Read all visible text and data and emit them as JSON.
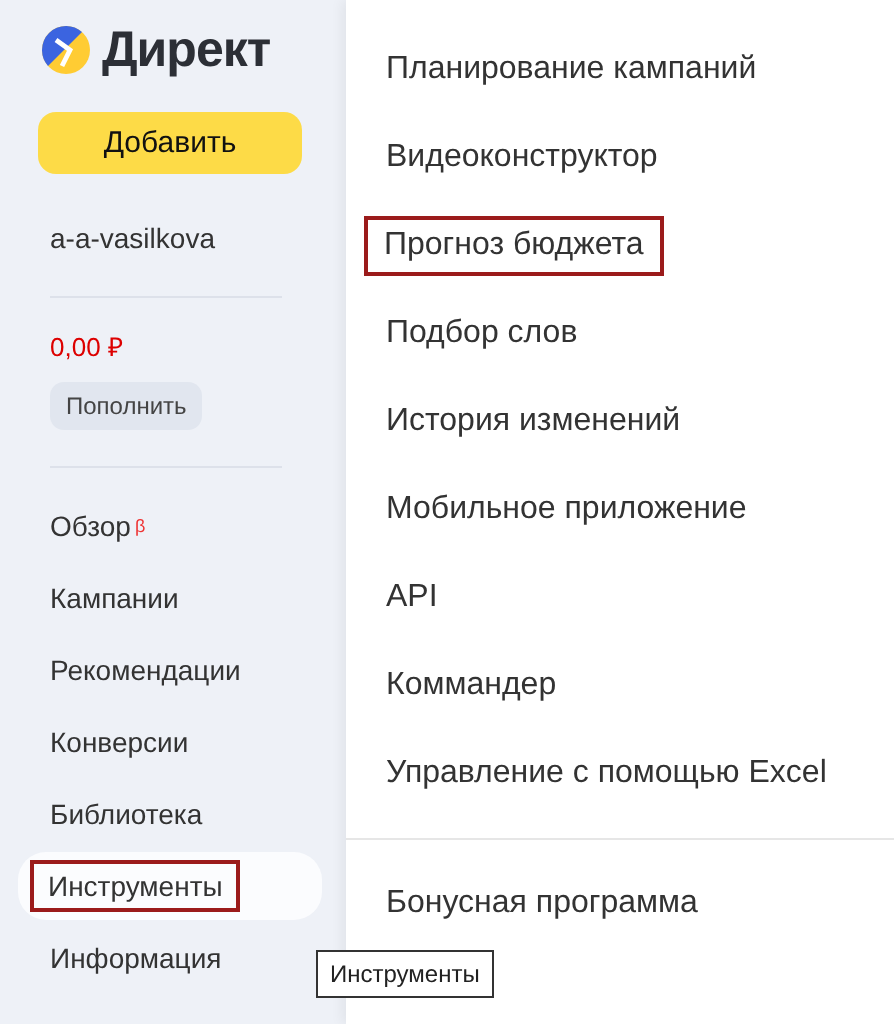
{
  "sidebar": {
    "logo": {
      "text": "Директ"
    },
    "add_button": "Добавить",
    "account": "a-a-vasilkova",
    "balance": "0,00 ₽",
    "top_up_button": "Пополнить",
    "nav": [
      {
        "label": "Обзор",
        "badge": "β",
        "selected": false,
        "highlighted": false
      },
      {
        "label": "Кампании",
        "selected": false,
        "highlighted": false
      },
      {
        "label": "Рекомендации",
        "selected": false,
        "highlighted": false
      },
      {
        "label": "Конверсии",
        "selected": false,
        "highlighted": false
      },
      {
        "label": "Библиотека",
        "selected": false,
        "highlighted": false
      },
      {
        "label": "Инструменты",
        "selected": true,
        "highlighted": true
      },
      {
        "label": "Информация",
        "selected": false,
        "highlighted": false
      }
    ]
  },
  "menu": {
    "groups": [
      [
        {
          "label": "Планирование кампаний",
          "highlighted": false
        },
        {
          "label": "Видеоконструктор",
          "highlighted": false
        },
        {
          "label": "Прогноз бюджета",
          "highlighted": true
        },
        {
          "label": "Подбор слов",
          "highlighted": false
        },
        {
          "label": "История изменений",
          "highlighted": false
        },
        {
          "label": "Мобильное приложение",
          "highlighted": false
        },
        {
          "label": "API",
          "highlighted": false
        },
        {
          "label": "Коммандер",
          "highlighted": false
        },
        {
          "label": "Управление с помощью Excel",
          "highlighted": false
        }
      ],
      [
        {
          "label": "Бонусная программа",
          "highlighted": false
        }
      ]
    ]
  },
  "tooltip": "Инструменты"
}
